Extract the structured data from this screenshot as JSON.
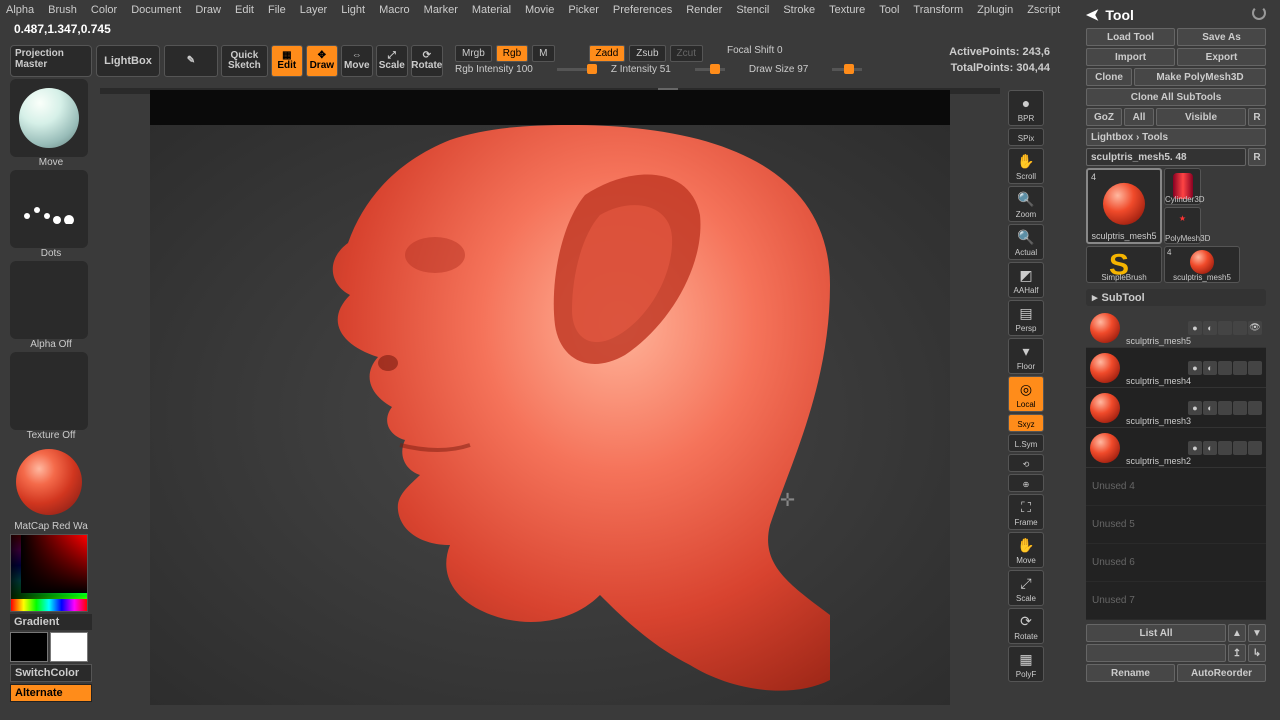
{
  "menu": [
    "Alpha",
    "Brush",
    "Color",
    "Document",
    "Draw",
    "Edit",
    "File",
    "Layer",
    "Light",
    "Macro",
    "Marker",
    "Material",
    "Movie",
    "Picker",
    "Preferences",
    "Render",
    "Stencil",
    "Stroke",
    "Texture",
    "Tool",
    "Transform",
    "Zplugin",
    "Zscript"
  ],
  "coords": "0.487,1.347,0.745",
  "left": {
    "proj1": "Projection",
    "proj2": "Master",
    "lightbox": "LightBox",
    "brush_label": "Move",
    "stroke_label": "Dots",
    "alpha_label": "Alpha Off",
    "texture_label": "Texture Off",
    "mat_label": "MatCap Red Wa",
    "gradient": "Gradient",
    "switch": "SwitchColor",
    "alternate": "Alternate"
  },
  "topbar": {
    "quick1": "Quick",
    "quick2": "Sketch",
    "edit": "Edit",
    "draw": "Draw",
    "move": "Move",
    "scale": "Scale",
    "rotate": "Rotate",
    "mrgb": "Mrgb",
    "rgb": "Rgb",
    "m": "M",
    "zadd": "Zadd",
    "zsub": "Zsub",
    "zcut": "Zcut",
    "focal": "Focal Shift 0",
    "rgb_int": "Rgb Intensity 100",
    "z_int": "Z Intensity 51",
    "draw_size": "Draw Size 97"
  },
  "points": {
    "active": "ActivePoints: 243,6",
    "total": "TotalPoints: 304,44"
  },
  "view": {
    "bpr": "BPR",
    "spix": "SPix",
    "scroll": "Scroll",
    "zoom": "Zoom",
    "actual": "Actual",
    "aahalf": "AAHalf",
    "persp": "Persp",
    "floor": "Floor",
    "local": "Local",
    "sym": "Sxyz",
    "lsym": "L.Sym",
    "frame": "Frame",
    "move": "Move",
    "scale": "Scale",
    "rotate": "Rotate",
    "polyf": "PolyF"
  },
  "tool": {
    "title": "Tool",
    "load": "Load Tool",
    "save": "Save As",
    "import": "Import",
    "export": "Export",
    "clone": "Clone",
    "makepm": "Make PolyMesh3D",
    "cloneall": "Clone All SubTools",
    "goz": "GoZ",
    "all": "All",
    "visible": "Visible",
    "r": "R",
    "lightbox_tools": "Lightbox › Tools",
    "current_tool": "sculptris_mesh5. 48",
    "cells": {
      "a": "sculptris_mesh5",
      "b": "Cylinder3D",
      "c": "SimpleBrush",
      "d": "PolyMesh3D",
      "e": "sculptris_mesh5"
    }
  },
  "subtool": {
    "title": "SubTool",
    "items": [
      "sculptris_mesh5",
      "sculptris_mesh4",
      "sculptris_mesh3",
      "sculptris_mesh2"
    ],
    "unused": [
      "Unused 4",
      "Unused 5",
      "Unused 6",
      "Unused 7"
    ],
    "listall": "List All",
    "rename": "Rename",
    "reorder": "AutoReorder"
  }
}
